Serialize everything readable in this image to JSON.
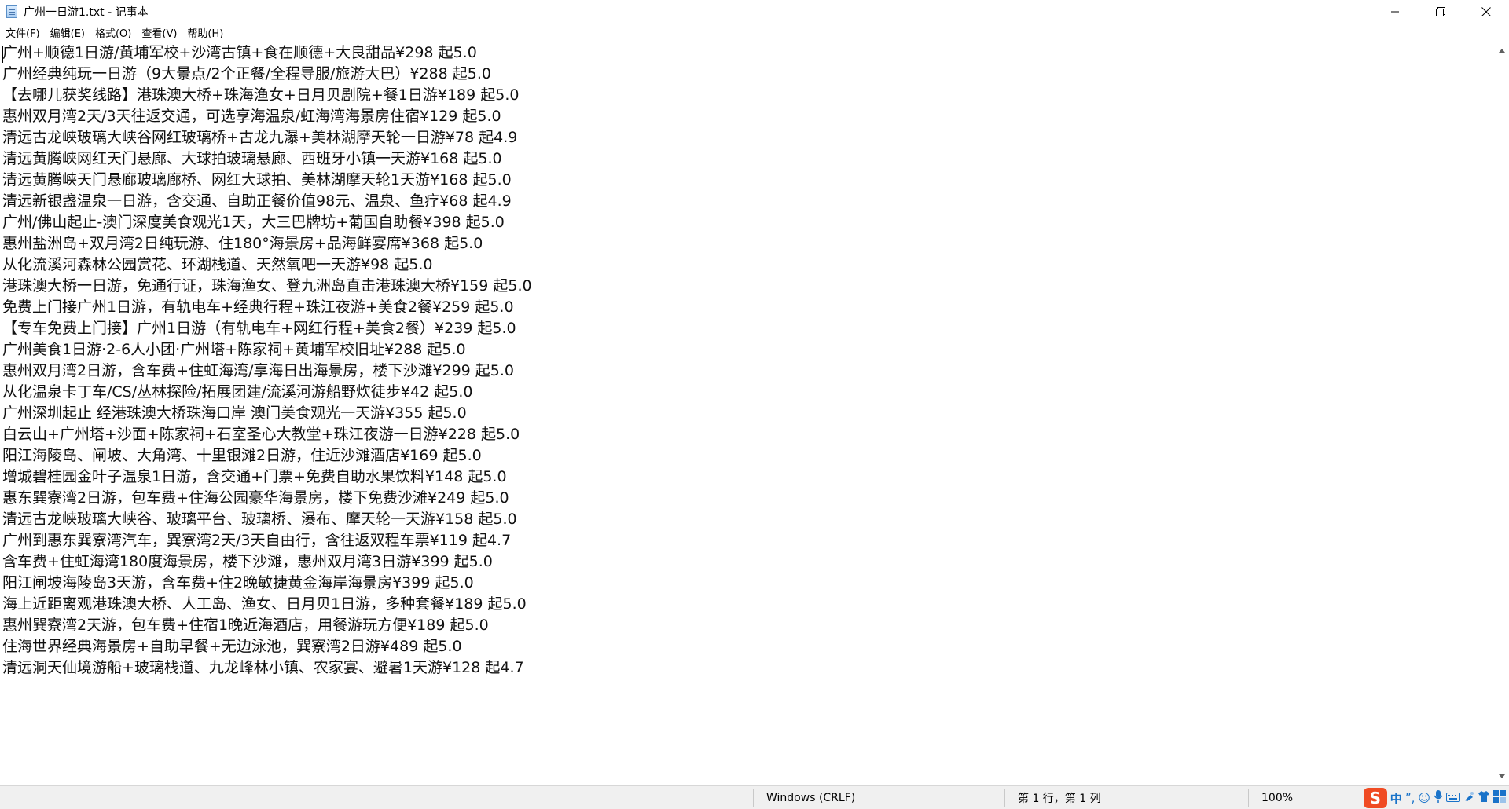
{
  "window": {
    "title": "广州一日游1.txt - 记事本",
    "controls": {
      "minimize": "—",
      "maximize": "❐",
      "close": "✕"
    }
  },
  "menu": [
    "文件(F)",
    "编辑(E)",
    "格式(O)",
    "查看(V)",
    "帮助(H)"
  ],
  "editor": {
    "lines": [
      "广州+顺德1日游/黄埔军校+沙湾古镇+食在顺德+大良甜品¥298 起5.0",
      "广州经典纯玩一日游（9大景点/2个正餐/全程导服/旅游大巴）¥288 起5.0",
      "【去哪儿获奖线路】港珠澳大桥+珠海渔女+日月贝剧院+餐1日游¥189 起5.0",
      "惠州双月湾2天/3天往返交通，可选享海温泉/虹海湾海景房住宿¥129 起5.0",
      "清远古龙峡玻璃大峡谷网红玻璃桥+古龙九瀑+美林湖摩天轮一日游¥78 起4.9",
      "清远黄腾峡网红天门悬廊、大球拍玻璃悬廊、西班牙小镇一天游¥168 起5.0",
      "清远黄腾峡天门悬廊玻璃廊桥、网红大球拍、美林湖摩天轮1天游¥168 起5.0",
      "清远新银盏温泉一日游，含交通、自助正餐价值98元、温泉、鱼疗¥68 起4.9",
      "广州/佛山起止-澳门深度美食观光1天，大三巴牌坊+葡国自助餐¥398 起5.0",
      "惠州盐洲岛+双月湾2日纯玩游、住180°海景房+品海鲜宴席¥368 起5.0",
      "从化流溪河森林公园赏花、环湖栈道、天然氧吧一天游¥98 起5.0",
      "港珠澳大桥一日游，免通行证，珠海渔女、登九洲岛直击港珠澳大桥¥159 起5.0",
      "免费上门接广州1日游，有轨电车+经典行程+珠江夜游+美食2餐¥259 起5.0",
      "【专车免费上门接】广州1日游（有轨电车+网红行程+美食2餐）¥239 起5.0",
      "广州美食1日游·2-6人小团·广州塔+陈家祠+黄埔军校旧址¥288 起5.0",
      "惠州双月湾2日游，含车费+住虹海湾/享海日出海景房，楼下沙滩¥299 起5.0",
      "从化温泉卡丁车/CS/丛林探险/拓展团建/流溪河游船野炊徒步¥42 起5.0",
      "广州深圳起止 经港珠澳大桥珠海口岸 澳门美食观光一天游¥355 起5.0",
      "白云山+广州塔+沙面+陈家祠+石室圣心大教堂+珠江夜游一日游¥228 起5.0",
      "阳江海陵岛、闸坡、大角湾、十里银滩2日游，住近沙滩酒店¥169 起5.0",
      "增城碧桂园金叶子温泉1日游，含交通+门票+免费自助水果饮料¥148 起5.0",
      "惠东巽寮湾2日游，包车费+住海公园豪华海景房，楼下免费沙滩¥249 起5.0",
      "清远古龙峡玻璃大峡谷、玻璃平台、玻璃桥、瀑布、摩天轮一天游¥158 起5.0",
      "广州到惠东巽寮湾汽车，巽寮湾2天/3天自由行，含往返双程车票¥119 起4.7",
      "含车费+住虹海湾180度海景房，楼下沙滩，惠州双月湾3日游¥399 起5.0",
      "阳江闸坡海陵岛3天游，含车费+住2晚敏捷黄金海岸海景房¥399 起5.0",
      "海上近距离观港珠澳大桥、人工岛、渔女、日月贝1日游，多种套餐¥189 起5.0",
      "惠州巽寮湾2天游，包车费+住宿1晚近海酒店，用餐游玩方便¥189 起5.0",
      "住海世界经典海景房+自助早餐+无边泳池，巽寮湾2日游¥489 起5.0",
      "清远洞天仙境游船+玻璃栈道、九龙峰林小镇、农家宴、避暑1天游¥128 起4.7"
    ]
  },
  "status": {
    "line_ending": "Windows (CRLF)",
    "position": "第 1 行，第 1 列",
    "zoom": "100%"
  },
  "ime": {
    "logo": "S",
    "mode": "中",
    "icons": [
      "punctuation-icon",
      "emoji-icon",
      "mic-icon",
      "keyboard-icon",
      "skin-icon",
      "shirt-icon",
      "toolbox-icon"
    ]
  },
  "colors": {
    "ime_brand": "#f04b23",
    "ime_blue": "#1a73c9",
    "statusbar_bg": "#f0f0f0"
  }
}
